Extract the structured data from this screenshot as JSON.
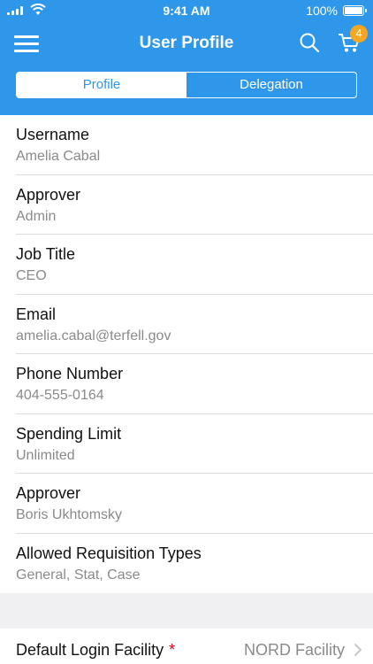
{
  "status_bar": {
    "time": "9:41 AM",
    "battery": "100%"
  },
  "nav": {
    "title": "User Profile",
    "cart_count": "4",
    "menu_icon": "hamburger-icon",
    "search_icon": "search-icon",
    "cart_icon": "cart-icon"
  },
  "tabs": [
    {
      "label": "Profile",
      "active": true
    },
    {
      "label": "Delegation",
      "active": false
    }
  ],
  "fields": [
    {
      "label": "Username",
      "value": "Amelia Cabal"
    },
    {
      "label": "Approver",
      "value": "Admin"
    },
    {
      "label": "Job Title",
      "value": "CEO"
    },
    {
      "label": "Email",
      "value": "amelia.cabal@terfell.gov"
    },
    {
      "label": "Phone Number",
      "value": "404-555-0164"
    },
    {
      "label": "Spending Limit",
      "value": "Unlimited"
    },
    {
      "label": "Approver",
      "value": "Boris Ukhtomsky"
    },
    {
      "label": "Allowed Requisition Types",
      "value": "General, Stat, Case"
    }
  ],
  "facility": {
    "label": "Default Login Facility",
    "required_mark": "*",
    "value": "NORD Facility"
  },
  "colors": {
    "primary": "#2f97ea",
    "badge": "#f5a623",
    "required": "#d0021b"
  }
}
